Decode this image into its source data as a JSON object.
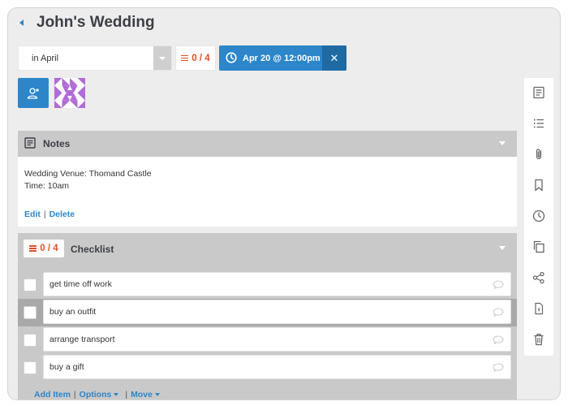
{
  "header": {
    "title": "John's Wedding"
  },
  "toolbar": {
    "due_select_value": "in April",
    "checklist_progress": "0 / 4",
    "due_date_label": "Apr 20 @ 12:00pm",
    "close_glyph": "✕"
  },
  "notes": {
    "title": "Notes",
    "lines": [
      "Wedding Venue: Thomand Castle",
      "Time: 10am"
    ],
    "edit_label": "Edit",
    "delete_label": "Delete",
    "separator": "|"
  },
  "checklist": {
    "progress": "0 / 4",
    "title": "Checklist",
    "items": [
      {
        "text": "get time off work",
        "checked": false
      },
      {
        "text": "buy an outfit",
        "checked": false
      },
      {
        "text": "arrange transport",
        "checked": false
      },
      {
        "text": "buy a gift",
        "checked": false
      }
    ],
    "add_item_label": "Add Item",
    "options_label": "Options",
    "move_label": "Move",
    "separator": "|"
  },
  "sidebar": {
    "icons": [
      "notes-icon",
      "checklist-icon",
      "attachment-icon",
      "bookmark-icon",
      "clock-icon",
      "copy-icon",
      "share-icon",
      "file-icon",
      "trash-icon"
    ]
  },
  "colors": {
    "accent": "#2d86c9",
    "accent_dark": "#1f6aa3",
    "progress_red": "#e0502b",
    "panel_gray": "#c9c9c9"
  }
}
